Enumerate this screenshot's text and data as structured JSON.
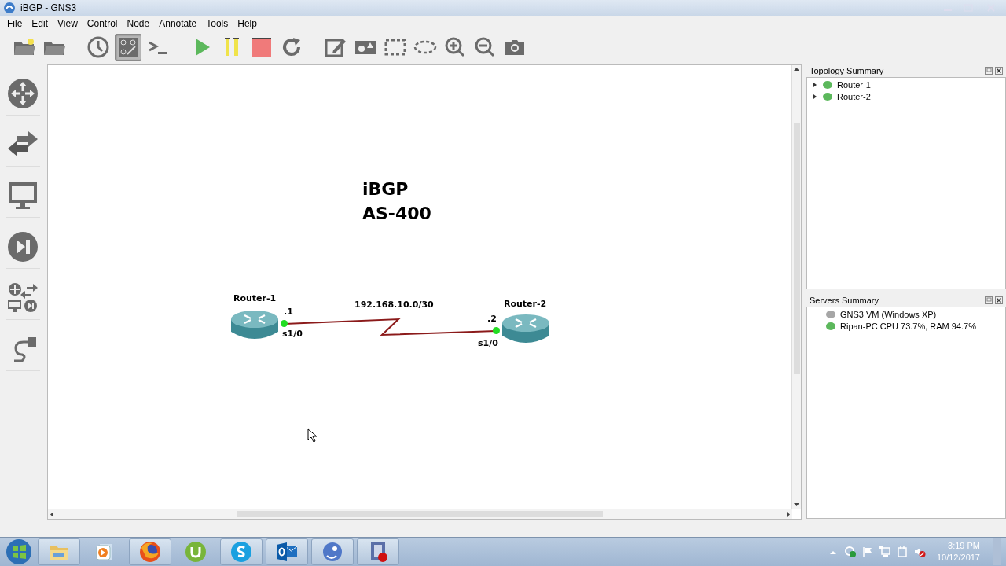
{
  "window": {
    "title": "iBGP - GNS3"
  },
  "menu": [
    "File",
    "Edit",
    "View",
    "Control",
    "Node",
    "Annotate",
    "Tools",
    "Help"
  ],
  "toolbar": [
    [
      {
        "kind": "new-project",
        "pressed": false
      },
      {
        "kind": "open-project",
        "pressed": false
      }
    ],
    [
      {
        "kind": "snapshot",
        "pressed": false
      },
      {
        "kind": "labels",
        "pressed": true
      },
      {
        "kind": "console",
        "pressed": false
      }
    ],
    [
      {
        "kind": "start",
        "pressed": false
      },
      {
        "kind": "suspend",
        "pressed": false
      },
      {
        "kind": "stop",
        "pressed": false
      },
      {
        "kind": "reload",
        "pressed": false
      }
    ],
    [
      {
        "kind": "note",
        "pressed": false
      },
      {
        "kind": "image",
        "pressed": false
      },
      {
        "kind": "rectangle",
        "pressed": false
      },
      {
        "kind": "ellipse",
        "pressed": false
      },
      {
        "kind": "zoom-in",
        "pressed": false
      },
      {
        "kind": "zoom-out",
        "pressed": false
      },
      {
        "kind": "screenshot",
        "pressed": false
      }
    ]
  ],
  "node_palette": [
    {
      "kind": "router"
    },
    {
      "kind": "switch"
    },
    {
      "kind": "end-device"
    },
    {
      "kind": "security"
    },
    {
      "kind": "all-devices"
    },
    {
      "kind": "link"
    }
  ],
  "canvas": {
    "note": [
      "iBGP",
      "AS-400"
    ],
    "nodes": [
      {
        "label": "Router-1"
      },
      {
        "label": "Router-2"
      }
    ],
    "link": {
      "label": "192.168.10.0/30",
      "ends": [
        {
          "address": ".1",
          "interface": "s1/0"
        },
        {
          "address": ".2",
          "interface": "s1/0"
        }
      ]
    }
  },
  "topology_summary": {
    "title": "Topology Summary",
    "items": [
      {
        "label": "Router-1",
        "expanded": false,
        "color": "#5cb85c"
      },
      {
        "label": "Router-2",
        "expanded": false,
        "color": "#5cb85c"
      }
    ]
  },
  "servers_summary": {
    "title": "Servers Summary",
    "items": [
      {
        "label": "GNS3 VM (Windows XP)",
        "color": "#a6a6a6"
      },
      {
        "label": "Ripan-PC CPU 73.7%, RAM 94.7%",
        "color": "#5cb85c"
      }
    ]
  },
  "taskbar": {
    "apps": [
      {
        "kind": "file-explorer",
        "running": true
      },
      {
        "kind": "media-player",
        "running": false
      },
      {
        "kind": "firefox",
        "running": true
      },
      {
        "kind": "torrent",
        "running": false
      },
      {
        "kind": "skype",
        "running": true
      },
      {
        "kind": "outlook",
        "running": true
      },
      {
        "kind": "chameleon",
        "running": true
      },
      {
        "kind": "recorder",
        "running": true
      }
    ],
    "tray": [
      {
        "kind": "show-hidden"
      },
      {
        "kind": "sync"
      },
      {
        "kind": "flag"
      },
      {
        "kind": "network"
      },
      {
        "kind": "power"
      },
      {
        "kind": "volume-muted"
      }
    ],
    "time": "3:19 PM",
    "date": "10/12/2017"
  }
}
